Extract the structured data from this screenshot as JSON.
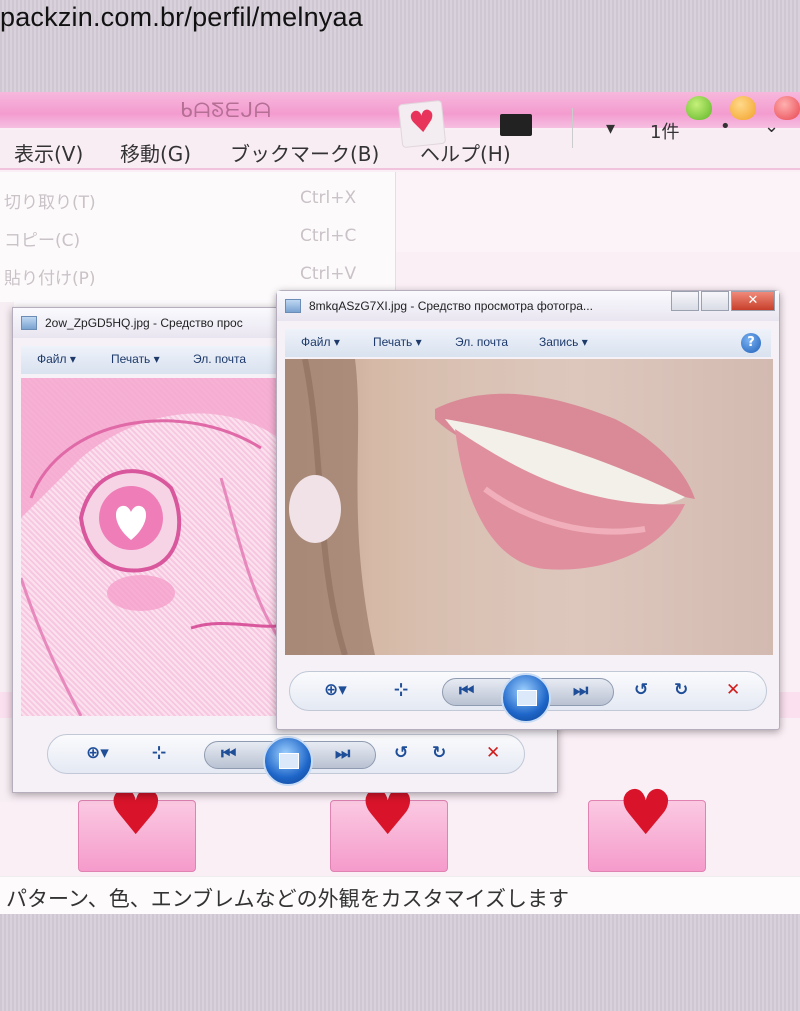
{
  "watermark": "packzin.com.br/perfil/melnyaa",
  "main_window": {
    "title": "ᑲᗩᘕᗴᒍᗩ",
    "menu": [
      "表示(V)",
      "移動(G)",
      "ブックマーク(B)",
      "ヘルプ(H)"
    ],
    "dropdown": [
      {
        "label": "切り取り(T)",
        "shortcut": "Ctrl+X"
      },
      {
        "label": "コピー(C)",
        "shortcut": "Ctrl+C"
      },
      {
        "label": "貼り付け(P)",
        "shortcut": "Ctrl+V"
      }
    ],
    "toolbar_text": "1件",
    "status_text": "パターン、色、エンブレムなどの外観をカスタマイズします"
  },
  "viewer_left": {
    "title": "2ow_ZpGD5HQ.jpg - Средство прос",
    "toolbar": [
      "Файл ▾",
      "Печать ▾",
      "Эл. почта"
    ]
  },
  "viewer_right": {
    "title": "8mkqASzG7XI.jpg - Средство просмотра фотогра...",
    "toolbar": [
      "Файл ▾",
      "Печать ▾",
      "Эл. почта",
      "Запись ▾"
    ],
    "help": "?"
  },
  "nav_glyphs": {
    "zoom": "⊕▾",
    "fit": "⊹",
    "prev": "⏮",
    "next": "⏭",
    "rotate_ccw": "↺",
    "rotate_cw": "↻",
    "delete": "✕"
  },
  "colors": {
    "title_pink": "#f39ccf",
    "window_bg": "#fbeff6",
    "heart_red": "#d9142a"
  }
}
